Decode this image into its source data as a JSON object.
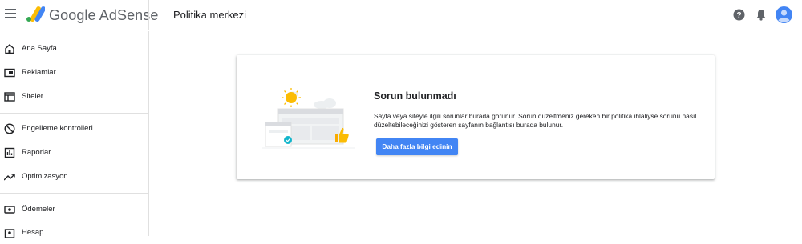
{
  "header": {
    "brand": "Google AdSense",
    "page_title": "Politika merkezi",
    "icons": [
      "menu-icon",
      "adsense-logo",
      "help-icon",
      "bell-icon",
      "avatar"
    ]
  },
  "sidebar": {
    "items": [
      {
        "label": "Ana Sayfa",
        "icon": "home-icon"
      },
      {
        "label": "Reklamlar",
        "icon": "ads-icon"
      },
      {
        "label": "Siteler",
        "icon": "sites-icon"
      },
      {
        "label": "Engelleme kontrolleri",
        "icon": "block-icon"
      },
      {
        "label": "Raporlar",
        "icon": "reports-icon"
      },
      {
        "label": "Optimizasyon",
        "icon": "trending-icon"
      },
      {
        "label": "Ödemeler",
        "icon": "payments-icon"
      },
      {
        "label": "Hesap",
        "icon": "account-icon"
      }
    ]
  },
  "main": {
    "card": {
      "title": "Sorun bulunmadı",
      "body": "Sayfa veya siteyle ilgili sorunlar burada görünür. Sorun düzeltmeniz gereken bir politika ihlaliyse sorunu nasıl düzeltebileceğinizi gösteren sayfanın bağlantısı burada bulunur.",
      "button_label": "Daha fazla bilgi edinin"
    }
  },
  "colors": {
    "accent": "#4285f4",
    "text": "#202124",
    "icon": "#5f6368",
    "divider": "#e0e0e0"
  }
}
